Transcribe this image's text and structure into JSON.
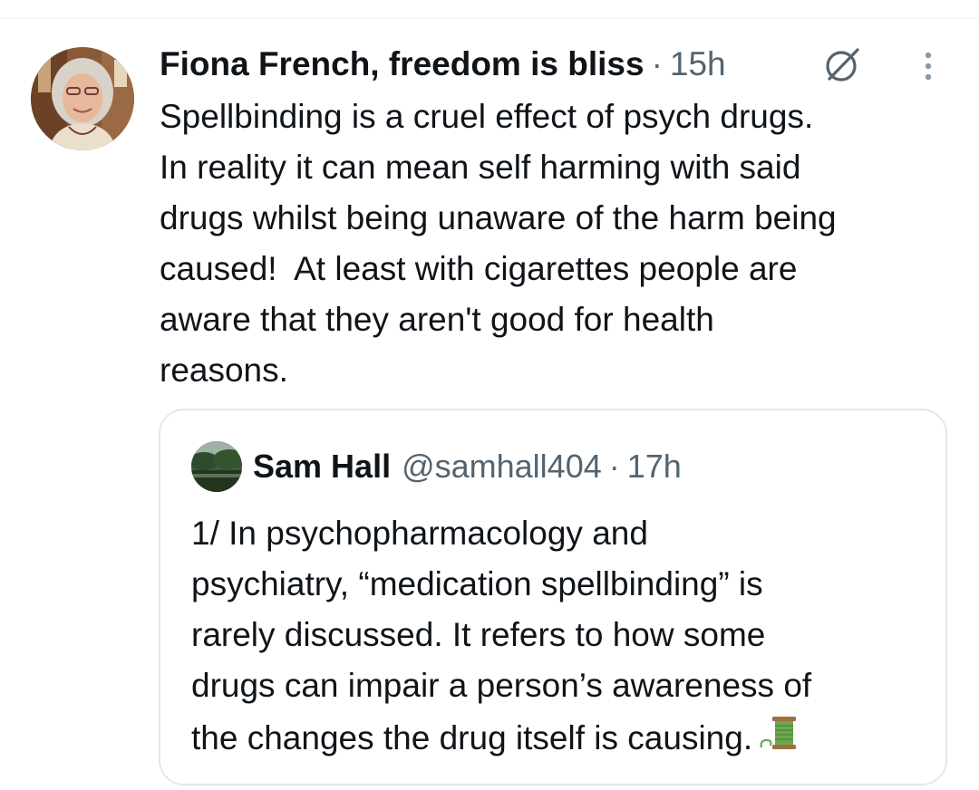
{
  "tweet": {
    "author_name": "Fiona French, freedom is bliss",
    "separator": "·",
    "time": "15h",
    "text": "Spellbinding is a cruel effect of psych drugs.\nIn reality it can mean self harming with said\ndrugs whilst being unaware of the harm being\ncaused!  At least with cigarettes people are\naware that they aren't good for health\nreasons.",
    "icons": {
      "grok": "grok-slash-icon",
      "more": "more-vertical-icon",
      "avatar": "profile-photo"
    }
  },
  "quote": {
    "author_name": "Sam Hall",
    "handle": "@samhall404",
    "separator": "·",
    "time": "17h",
    "text": "1/ In psychopharmacology and\npsychiatry, “medication spellbinding” is\nrarely discussed. It refers to how some\ndrugs can impair a person’s awareness of\nthe changes the drug itself is causing.",
    "trailing_icon": "thread-spool-emoji"
  },
  "colors": {
    "text_primary": "#0f1419",
    "text_secondary": "#536471",
    "border": "#e1e8ed",
    "background": "#ffffff"
  }
}
